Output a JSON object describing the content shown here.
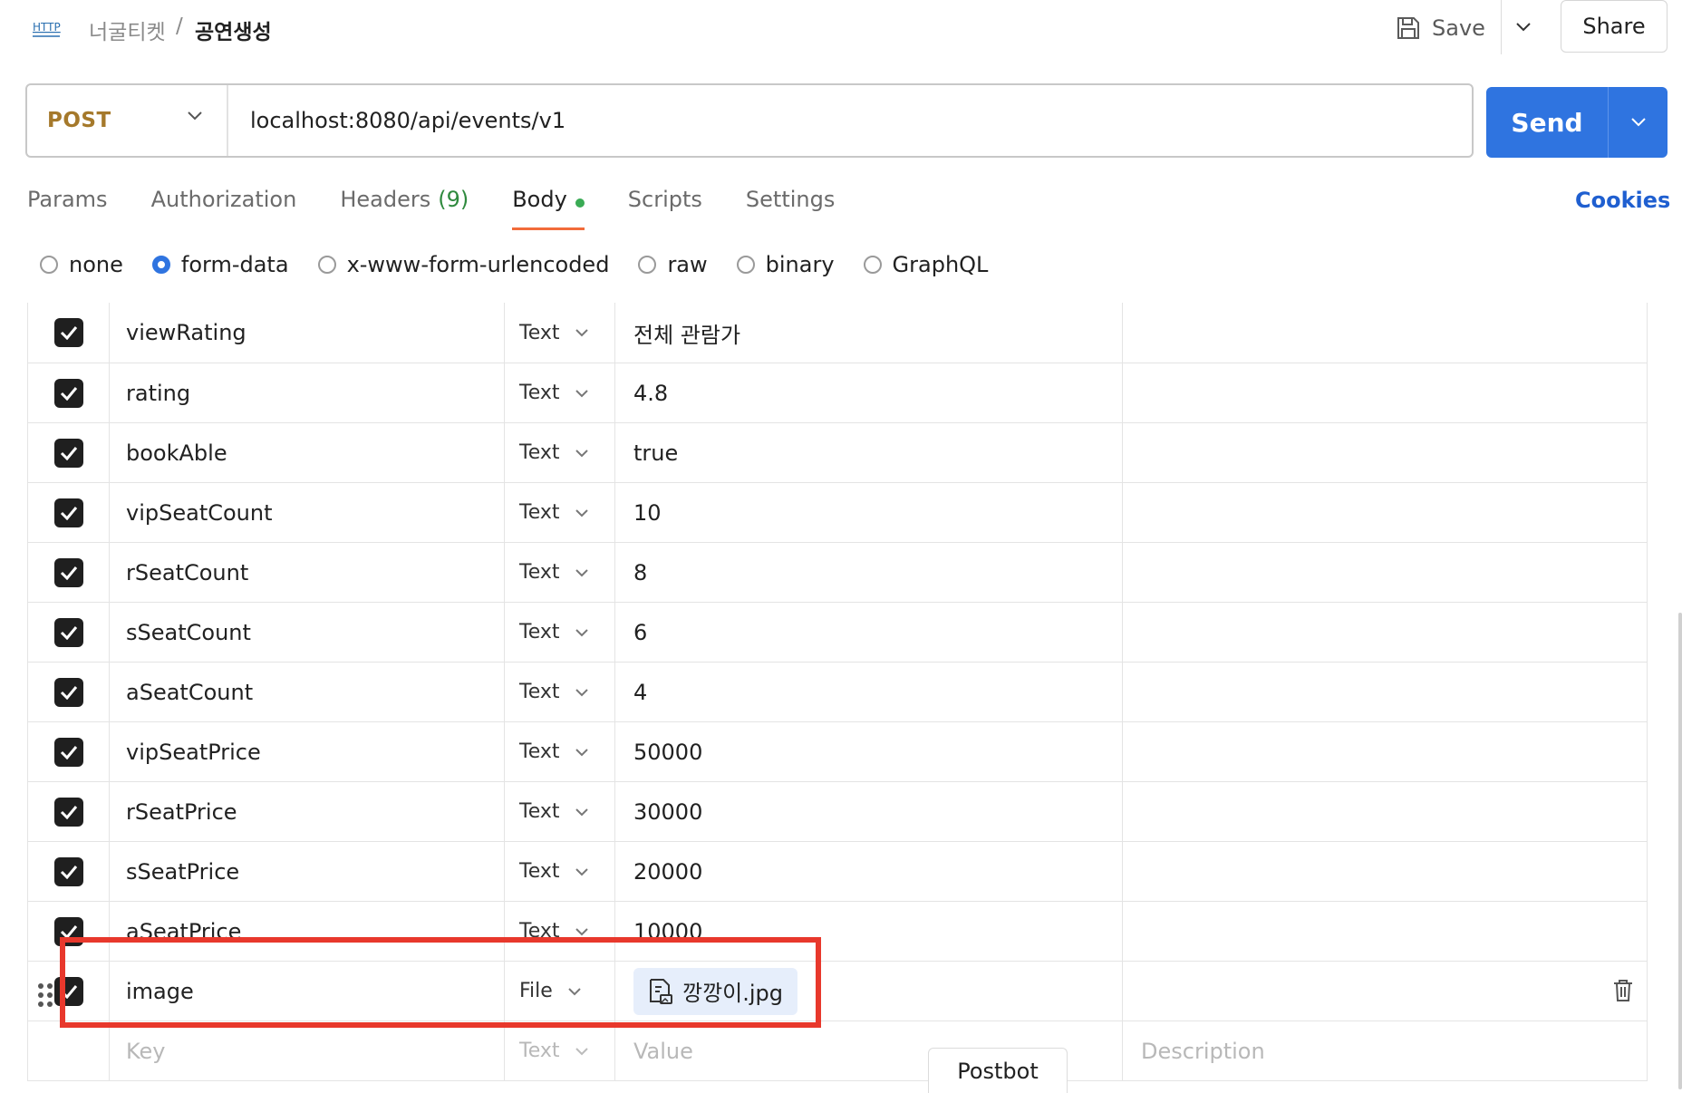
{
  "header": {
    "icon_label": "HTTP",
    "collection": "너굴티켓",
    "separator": "/",
    "request_name": "공연생성",
    "save_label": "Save",
    "share_label": "Share"
  },
  "request": {
    "method": "POST",
    "url": "localhost:8080/api/events/v1",
    "send_label": "Send"
  },
  "tabs": [
    {
      "label": "Params"
    },
    {
      "label": "Authorization"
    },
    {
      "label": "Headers",
      "count": "(9)"
    },
    {
      "label": "Body",
      "active": true
    },
    {
      "label": "Scripts"
    },
    {
      "label": "Settings"
    }
  ],
  "cookies_label": "Cookies",
  "body_types": [
    {
      "label": "none"
    },
    {
      "label": "form-data",
      "selected": true
    },
    {
      "label": "x-www-form-urlencoded"
    },
    {
      "label": "raw"
    },
    {
      "label": "binary"
    },
    {
      "label": "GraphQL"
    }
  ],
  "rows": [
    {
      "key": "viewRating",
      "type": "Text",
      "value": "전체 관람가"
    },
    {
      "key": "rating",
      "type": "Text",
      "value": "4.8"
    },
    {
      "key": "bookAble",
      "type": "Text",
      "value": "true"
    },
    {
      "key": "vipSeatCount",
      "type": "Text",
      "value": "10"
    },
    {
      "key": "rSeatCount",
      "type": "Text",
      "value": "8"
    },
    {
      "key": "sSeatCount",
      "type": "Text",
      "value": "6"
    },
    {
      "key": "aSeatCount",
      "type": "Text",
      "value": "4"
    },
    {
      "key": "vipSeatPrice",
      "type": "Text",
      "value": "50000"
    },
    {
      "key": "rSeatPrice",
      "type": "Text",
      "value": "30000"
    },
    {
      "key": "sSeatPrice",
      "type": "Text",
      "value": "20000"
    },
    {
      "key": "aSeatPrice",
      "type": "Text",
      "value": "10000"
    }
  ],
  "file_row": {
    "key": "image",
    "type": "File",
    "value": "깡깡이.jpg"
  },
  "placeholder_row": {
    "key": "Key",
    "type": "Text",
    "value": "Value",
    "description": "Description"
  },
  "postbot_label": "Postbot",
  "colors": {
    "accent": "#2f74e0",
    "highlight": "#e8382c",
    "tab_underline": "#f26b3a"
  }
}
